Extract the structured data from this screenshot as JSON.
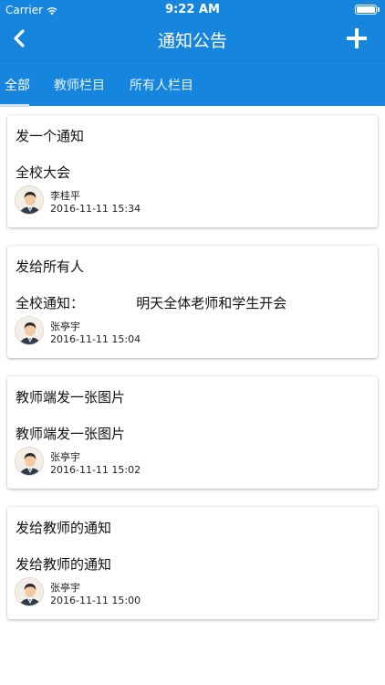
{
  "status_bar": {
    "carrier": "Carrier",
    "time": "9:22 AM"
  },
  "nav": {
    "title": "通知公告",
    "back_icon": "chevron-left-icon",
    "add_icon": "plus-icon"
  },
  "tabs": [
    {
      "label": "全部",
      "active": true
    },
    {
      "label": "教师栏目",
      "active": false
    },
    {
      "label": "所有人栏目",
      "active": false
    }
  ],
  "colors": {
    "header": "#1685dd",
    "text": "#111111",
    "card_bg": "#ffffff"
  },
  "notices": [
    {
      "title": "发一个通知",
      "body": "全校大会",
      "author": "李桂平",
      "time": "2016-11-11 15:34"
    },
    {
      "title": "发给所有人",
      "body": "全校通知：            明天全体老师和学生开会",
      "author": "张亭宇",
      "time": "2016-11-11 15:04"
    },
    {
      "title": "教师端发一张图片",
      "body": "教师端发一张图片",
      "author": "张亭宇",
      "time": "2016-11-11 15:02"
    },
    {
      "title": "发给教师的通知",
      "body": "发给教师的通知",
      "author": "张亭宇",
      "time": "2016-11-11 15:00"
    }
  ]
}
